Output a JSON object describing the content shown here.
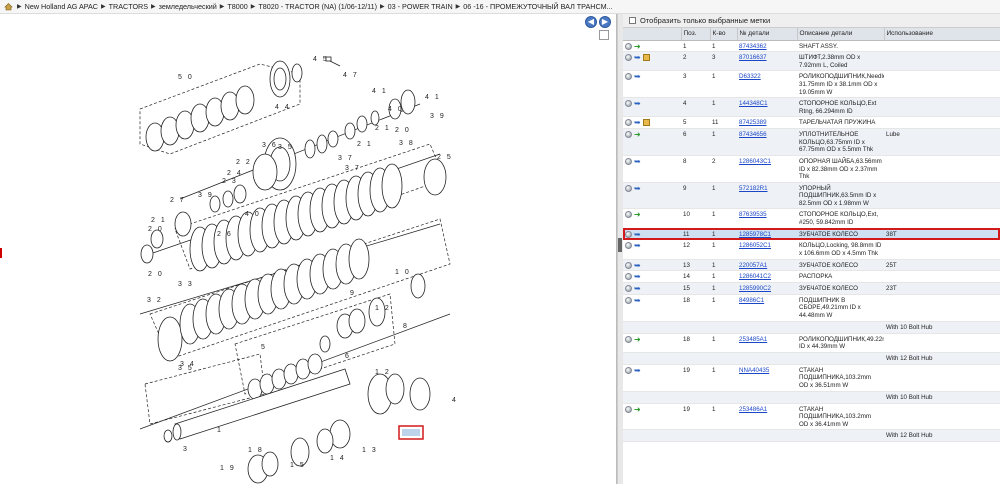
{
  "breadcrumb": {
    "items": [
      "New Holland AG APAC",
      "TRACTORS",
      "земледельческий",
      "T8000",
      "T8020 - TRACTOR (NA) (1/06-12/11)",
      "03 - POWER TRAIN",
      "06 -16 - ПРОМЕЖУТОЧНЫЙ ВАЛ ТРАНСМ..."
    ]
  },
  "filter": {
    "label": "Отобразить только выбранные метки"
  },
  "table": {
    "headers": {
      "pos": "Поз.",
      "qty": "К-во",
      "part": "№ детали",
      "desc": "Описание детали",
      "usage": "Использование"
    },
    "rows": [
      {
        "icon": "green",
        "pos": "1",
        "qty": "1",
        "part": "87434362",
        "desc": "SHAFT ASSY.",
        "usage": ""
      },
      {
        "icon": "box",
        "pos": "2",
        "qty": "3",
        "part": "87016637",
        "desc": "ШТИФТ,2.38mm OD x 7.92mm L, Coiled",
        "usage": ""
      },
      {
        "icon": "blue",
        "pos": "3",
        "qty": "1",
        "part": "D63322",
        "desc": "РОЛИКОПОДШИПНИК,Needle, 31.75mm ID x 38.1mm OD x 19.05mm W",
        "usage": ""
      },
      {
        "icon": "blue",
        "pos": "4",
        "qty": "1",
        "part": "144348C1",
        "desc": "СТОПОРНОЕ КОЛЬЦО,Ext Rtng, 66.294mm ID",
        "usage": ""
      },
      {
        "icon": "box",
        "pos": "5",
        "qty": "11",
        "part": "87425389",
        "desc": "ТАРЕЛЬЧАТАЯ ПРУЖИНА",
        "usage": ""
      },
      {
        "icon": "green",
        "pos": "6",
        "qty": "1",
        "part": "87434656",
        "desc": "УПЛОТНИТЕЛЬНОЕ КОЛЬЦО,63.75mm ID x 67.75mm OD x 5.5mm Thk",
        "usage": "Lube"
      },
      {
        "icon": "blue",
        "pos": "8",
        "qty": "2",
        "part": "1286043C1",
        "desc": "ОПОРНАЯ ШАЙБА,63.56mm ID x 82.38mm OD x 2.37mm Thk",
        "usage": ""
      },
      {
        "icon": "blue",
        "pos": "9",
        "qty": "1",
        "part": "572182R1",
        "desc": "УПОРНЫЙ ПОДШИПНИК,63.5mm ID x 82.5mm OD x 1.98mm W",
        "usage": ""
      },
      {
        "icon": "green",
        "pos": "10",
        "qty": "1",
        "part": "87639535",
        "desc": "СТОПОРНОЕ КОЛЬЦО,Ext, #250, 59.842mm ID",
        "usage": ""
      },
      {
        "icon": "blue",
        "pos": "11",
        "qty": "1",
        "part": "1285978C1",
        "desc": "ЗУБЧАТОЕ КОЛЕСО",
        "usage": "38T",
        "selected": true
      },
      {
        "icon": "blue",
        "pos": "12",
        "qty": "1",
        "part": "1286052C1",
        "desc": "КОЛЬЦО,Locking, 98.8mm ID x 106.6mm OD x 4.5mm Thk",
        "usage": ""
      },
      {
        "icon": "blue",
        "pos": "13",
        "qty": "1",
        "part": "220057A1",
        "desc": "ЗУБЧАТОЕ КОЛЕСО",
        "usage": "25T"
      },
      {
        "icon": "blue",
        "pos": "14",
        "qty": "1",
        "part": "1286041C2",
        "desc": "РАСПОРКА",
        "usage": ""
      },
      {
        "icon": "blue",
        "pos": "15",
        "qty": "1",
        "part": "1285990C2",
        "desc": "ЗУБЧАТОЕ КОЛЕСО",
        "usage": "23T"
      },
      {
        "icon": "blue",
        "pos": "18",
        "qty": "1",
        "part": "84986C1",
        "desc": "ПОДШИПНИК В СБОРЕ,49.21mm ID x 44.48mm W",
        "usage": ""
      },
      {
        "sub": true,
        "usage": "With 10 Bolt Hub"
      },
      {
        "icon": "green",
        "pos": "18",
        "qty": "1",
        "part": "253485A1",
        "desc": "РОЛИКОПОДШИПНИК,49.22mm ID x 44.39mm W",
        "usage": ""
      },
      {
        "sub": true,
        "usage": "With 12 Bolt Hub"
      },
      {
        "icon": "blue",
        "pos": "19",
        "qty": "1",
        "part": "NNA40435",
        "desc": "СТАКАН ПОДШИПНИКА,103.2mm OD x 36.51mm W",
        "usage": ""
      },
      {
        "sub": true,
        "usage": "With 10 Bolt Hub"
      },
      {
        "icon": "green",
        "pos": "19",
        "qty": "1",
        "part": "253486A1",
        "desc": "СТАКАН ПОДШИПНИКА,103.2mm OD x 36.41mm W",
        "usage": ""
      },
      {
        "sub": true,
        "usage": "With 12 Bolt Hub"
      }
    ]
  },
  "diagram": {
    "callouts": [
      "1",
      "2",
      "3",
      "4",
      "5",
      "6",
      "7",
      "8",
      "9",
      "10",
      "11",
      "12",
      "13",
      "14",
      "15",
      "16",
      "17",
      "18",
      "19",
      "20",
      "21",
      "22",
      "23",
      "24",
      "25",
      "26",
      "27",
      "28",
      "29",
      "30",
      "31",
      "32",
      "33",
      "34",
      "35",
      "36",
      "37",
      "38",
      "39",
      "40",
      "41",
      "42",
      "43",
      "44",
      "45",
      "46",
      "47",
      "48",
      "49",
      "50"
    ]
  }
}
